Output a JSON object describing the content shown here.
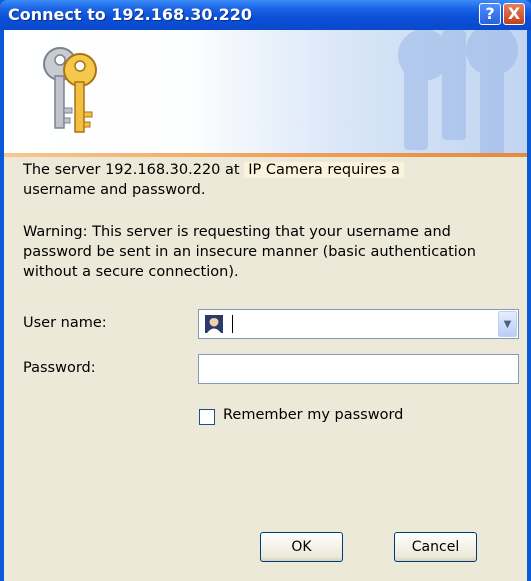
{
  "window": {
    "title": "Connect to 192.168.30.220",
    "help_label": "?",
    "close_label": "X"
  },
  "message": {
    "line1_prefix": "The server 192.168.30.220 at ",
    "realm": "IP Camera requires a",
    "line1_suffix": "username and password.",
    "warning": "Warning: This server is requesting that your username and password be sent in an insecure manner (basic authentication without a secure connection)."
  },
  "form": {
    "username_label": "User name:",
    "username_value": "",
    "password_label": "Password:",
    "password_value": "",
    "remember_label": "Remember my password",
    "remember_checked": false
  },
  "buttons": {
    "ok": "OK",
    "cancel": "Cancel"
  },
  "colors": {
    "titlebar": "#0a49cd",
    "dialog_bg": "#ece9d8",
    "accent_line": "#f3a35b"
  },
  "icons": [
    "keys-icon",
    "user-icon",
    "chevron-down-icon",
    "help-icon",
    "close-icon"
  ]
}
